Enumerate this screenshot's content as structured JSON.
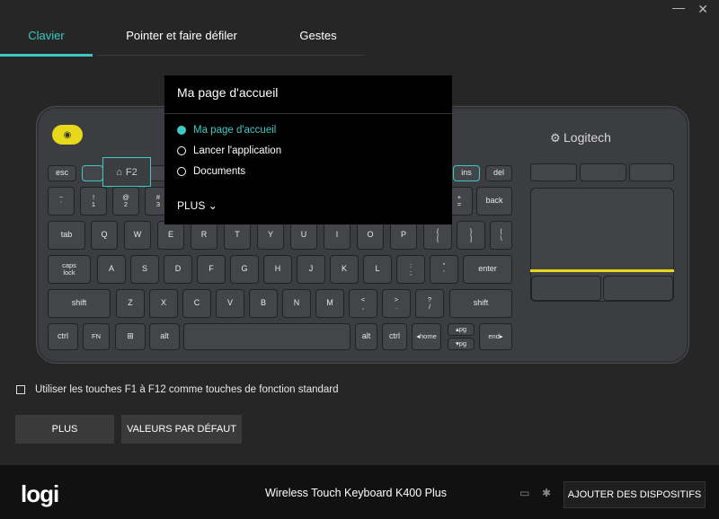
{
  "window": {
    "minimize_glyph": "—",
    "close_glyph": "✕"
  },
  "tabs": [
    {
      "label": "Clavier",
      "active": true
    },
    {
      "label": "Pointer et faire défiler",
      "active": false
    },
    {
      "label": "Gestes",
      "active": false
    }
  ],
  "colors": {
    "accent": "#3ec9c3",
    "highlight": "#e8d81a",
    "background": "#262626"
  },
  "keyboard": {
    "brand": "Logitech",
    "f2_callout": "F2",
    "keys": {
      "esc": "esc",
      "ins": "ins",
      "del": "del",
      "r1": [
        "~\n`",
        "!\n1",
        "@\n2",
        "#\n3"
      ],
      "plus": "+\n=",
      "back": "back",
      "tab": "tab",
      "row_q": [
        "Q",
        "W",
        "E",
        "R",
        "T",
        "Y",
        "U",
        "I",
        "O",
        "P"
      ],
      "brace_open": "{\n[",
      "brace_close": "}\n]",
      "pipe": "|\n\\",
      "caps": "caps\nlock",
      "row_a": [
        "A",
        "S",
        "D",
        "F",
        "G",
        "H",
        "J",
        "K",
        "L"
      ],
      "semicolon": ":\n;",
      "quote": "\"\n'",
      "enter": "enter",
      "shift_l": "shift",
      "row_z": [
        "Z",
        "X",
        "C",
        "V",
        "B",
        "N",
        "M"
      ],
      "lt": "<\n,",
      "gt": ">\n.",
      "qm": "?\n/",
      "shift_r": "shift",
      "ctrl_l": "ctrl",
      "fn": "FN",
      "win": "⊞",
      "alt_l": "alt",
      "alt_r": "alt",
      "ctrl_r": "ctrl",
      "home": "◂home",
      "pgup": "▴pg",
      "pgdn": "▾pg",
      "end": "end▸"
    }
  },
  "popup": {
    "title": "Ma page d'accueil",
    "options": [
      {
        "label": "Ma page d'accueil",
        "selected": true
      },
      {
        "label": "Lancer l'application",
        "selected": false
      },
      {
        "label": "Documents",
        "selected": false
      }
    ],
    "more_label": "PLUS"
  },
  "settings": {
    "fkeys_checkbox_label": "Utiliser les touches F1 à F12 comme touches de fonction standard",
    "fkeys_checked": false,
    "plus_button": "PLUS",
    "defaults_button": "VALEURS PAR DÉFAUT"
  },
  "footer": {
    "logo": "logi",
    "device_name": "Wireless Touch Keyboard K400 Plus",
    "add_devices_button": "AJOUTER DES DISPOSITIFS"
  }
}
